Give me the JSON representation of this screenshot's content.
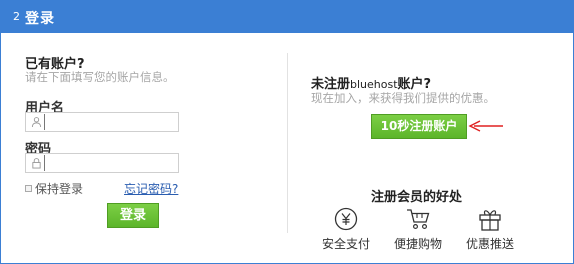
{
  "header": {
    "step": "2",
    "title": "登录"
  },
  "login": {
    "heading": "已有账户?",
    "hint": "请在下面填写您的账户信息。",
    "username_label": "用户名",
    "username_value": "",
    "password_label": "密码",
    "password_value": "",
    "remember_label": "保持登录",
    "forgot_link": "忘记密码?",
    "submit_label": "登录"
  },
  "register": {
    "heading_pre": "未注册",
    "heading_brand": "bluehost",
    "heading_post": "账户?",
    "hint": "现在加入，来获得我们提供的优惠。",
    "button_label": "10秒注册账户"
  },
  "benefits": {
    "title": "注册会员的好处",
    "items": [
      {
        "label": "安全支付",
        "icon": "yen-coin-icon"
      },
      {
        "label": "便捷购物",
        "icon": "shopping-cart-icon"
      },
      {
        "label": "优惠推送",
        "icon": "gift-icon"
      }
    ]
  },
  "colors": {
    "header": "#3b7fd4",
    "button": "#5cb52a",
    "arrow": "#e02020",
    "link": "#2a5db0"
  }
}
